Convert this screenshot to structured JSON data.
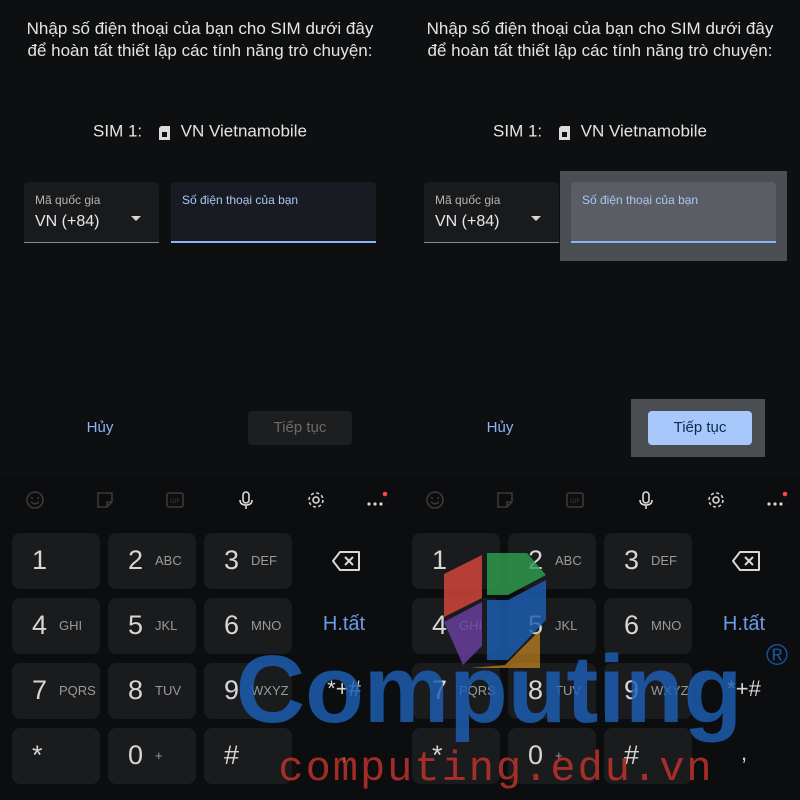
{
  "panels": [
    {
      "instruction": "Nhập số điện thoại của bạn cho SIM dưới đây để hoàn tất thiết lập các tính năng trò chuyện:",
      "sim_label": "SIM 1:",
      "sim_carrier": "VN Vietnamobile",
      "country_label": "Mã quốc gia",
      "country_value": "VN (+84)",
      "phone_placeholder": "Số điện thoại của bạn",
      "cancel_label": "Hủy",
      "continue_label": "Tiếp tục",
      "continue_enabled": false
    },
    {
      "instruction": "Nhập số điện thoại của bạn cho SIM dưới đây để hoàn tất thiết lập các tính năng trò chuyện:",
      "sim_label": "SIM 1:",
      "sim_carrier": "VN Vietnamobile",
      "country_label": "Mã quốc gia",
      "country_value": "VN (+84)",
      "phone_placeholder": "Số điện thoại của bạn",
      "cancel_label": "Hủy",
      "continue_label": "Tiếp tục",
      "continue_enabled": true
    }
  ],
  "keyboard": {
    "keys": [
      {
        "num": "1",
        "letters": ""
      },
      {
        "num": "2",
        "letters": "ABC"
      },
      {
        "num": "3",
        "letters": "DEF"
      },
      {
        "num": "4",
        "letters": "GHI"
      },
      {
        "num": "5",
        "letters": "JKL"
      },
      {
        "num": "6",
        "letters": "MNO"
      },
      {
        "num": "7",
        "letters": "PQRS"
      },
      {
        "num": "8",
        "letters": "TUV"
      },
      {
        "num": "9",
        "letters": "WXYZ"
      },
      {
        "num": "*",
        "letters": ""
      },
      {
        "num": "0",
        "letters": "+"
      },
      {
        "num": "#",
        "letters": ""
      }
    ],
    "done_label": "H.tất",
    "symbols_label": "*+#",
    "comma_label": ","
  },
  "watermark": {
    "brand": "Computing",
    "registered": "®",
    "url": "computing.edu.vn"
  },
  "colors": {
    "accent": "#8ab4f8",
    "button_active": "#a8c7fa",
    "watermark_blue": "#1c5fb4",
    "watermark_red": "#c0332b"
  }
}
